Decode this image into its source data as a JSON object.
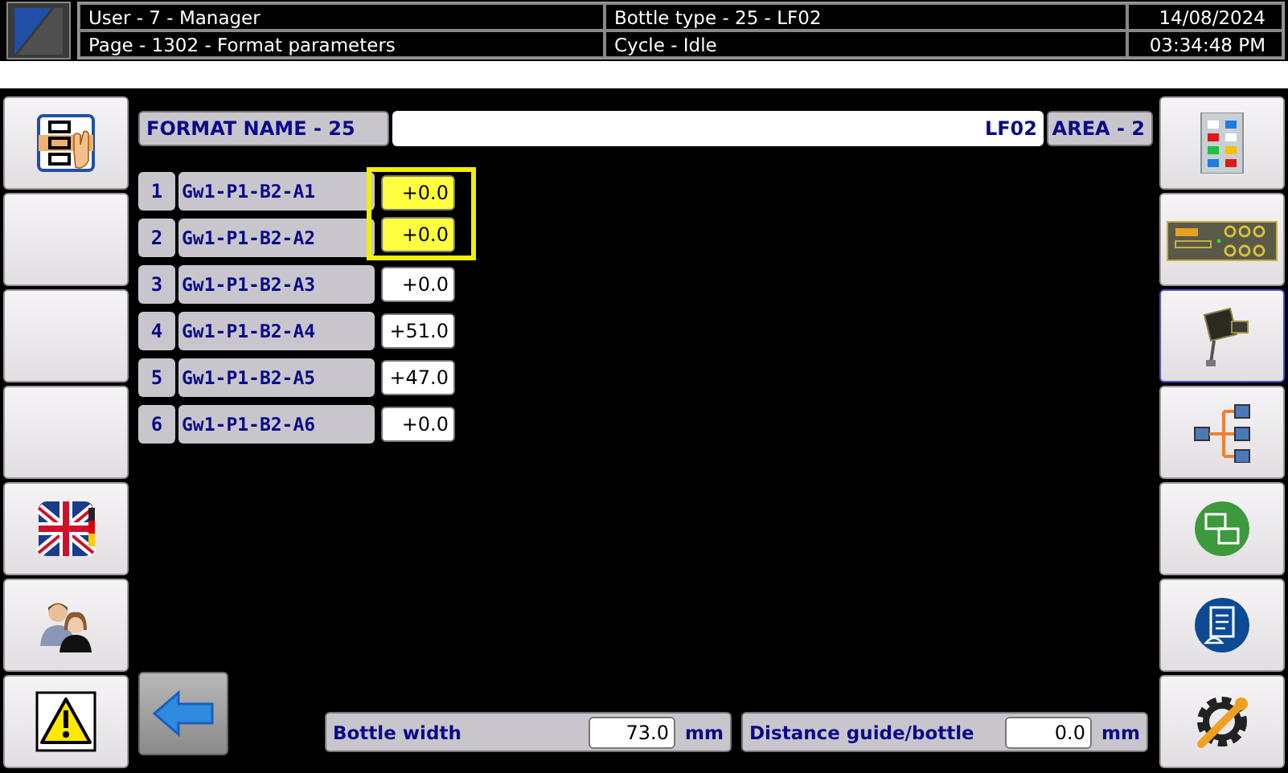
{
  "header": {
    "user": "User - 7 - Manager",
    "bottle_type": "Bottle type - 25 - LF02",
    "date": "14/08/2024",
    "page": "Page - 1302 - Format parameters",
    "cycle": "Cycle - Idle",
    "time": "03:34:48 PM"
  },
  "format": {
    "label": "FORMAT NAME - 25",
    "name": "LF02",
    "area": "AREA - 2"
  },
  "rows": [
    {
      "index": "1",
      "name": "Gw1-P1-B2-A1",
      "value": "+0.0",
      "highlighted": true
    },
    {
      "index": "2",
      "name": "Gw1-P1-B2-A2",
      "value": "+0.0",
      "highlighted": true
    },
    {
      "index": "3",
      "name": "Gw1-P1-B2-A3",
      "value": "+0.0",
      "highlighted": false
    },
    {
      "index": "4",
      "name": "Gw1-P1-B2-A4",
      "value": "+51.0",
      "highlighted": false
    },
    {
      "index": "5",
      "name": "Gw1-P1-B2-A5",
      "value": "+47.0",
      "highlighted": false
    },
    {
      "index": "6",
      "name": "Gw1-P1-B2-A6",
      "value": "+0.0",
      "highlighted": false
    }
  ],
  "left_buttons": [
    {
      "kind": "flowchart"
    },
    {
      "kind": "blank"
    },
    {
      "kind": "blank"
    },
    {
      "kind": "blank"
    },
    {
      "kind": "flag"
    },
    {
      "kind": "users"
    },
    {
      "kind": "warning"
    }
  ],
  "right_buttons": [
    {
      "kind": "panel",
      "selected": false
    },
    {
      "kind": "board",
      "selected": false
    },
    {
      "kind": "sensor",
      "selected": true
    },
    {
      "kind": "network",
      "selected": false
    },
    {
      "kind": "windows",
      "selected": false
    },
    {
      "kind": "document",
      "selected": false
    },
    {
      "kind": "tools",
      "selected": false
    }
  ],
  "bottom_fields": [
    {
      "label": "Bottle width",
      "value": "73.0",
      "unit": "mm"
    },
    {
      "label": "Distance guide/bottle",
      "value": "0.0",
      "unit": "mm"
    }
  ]
}
